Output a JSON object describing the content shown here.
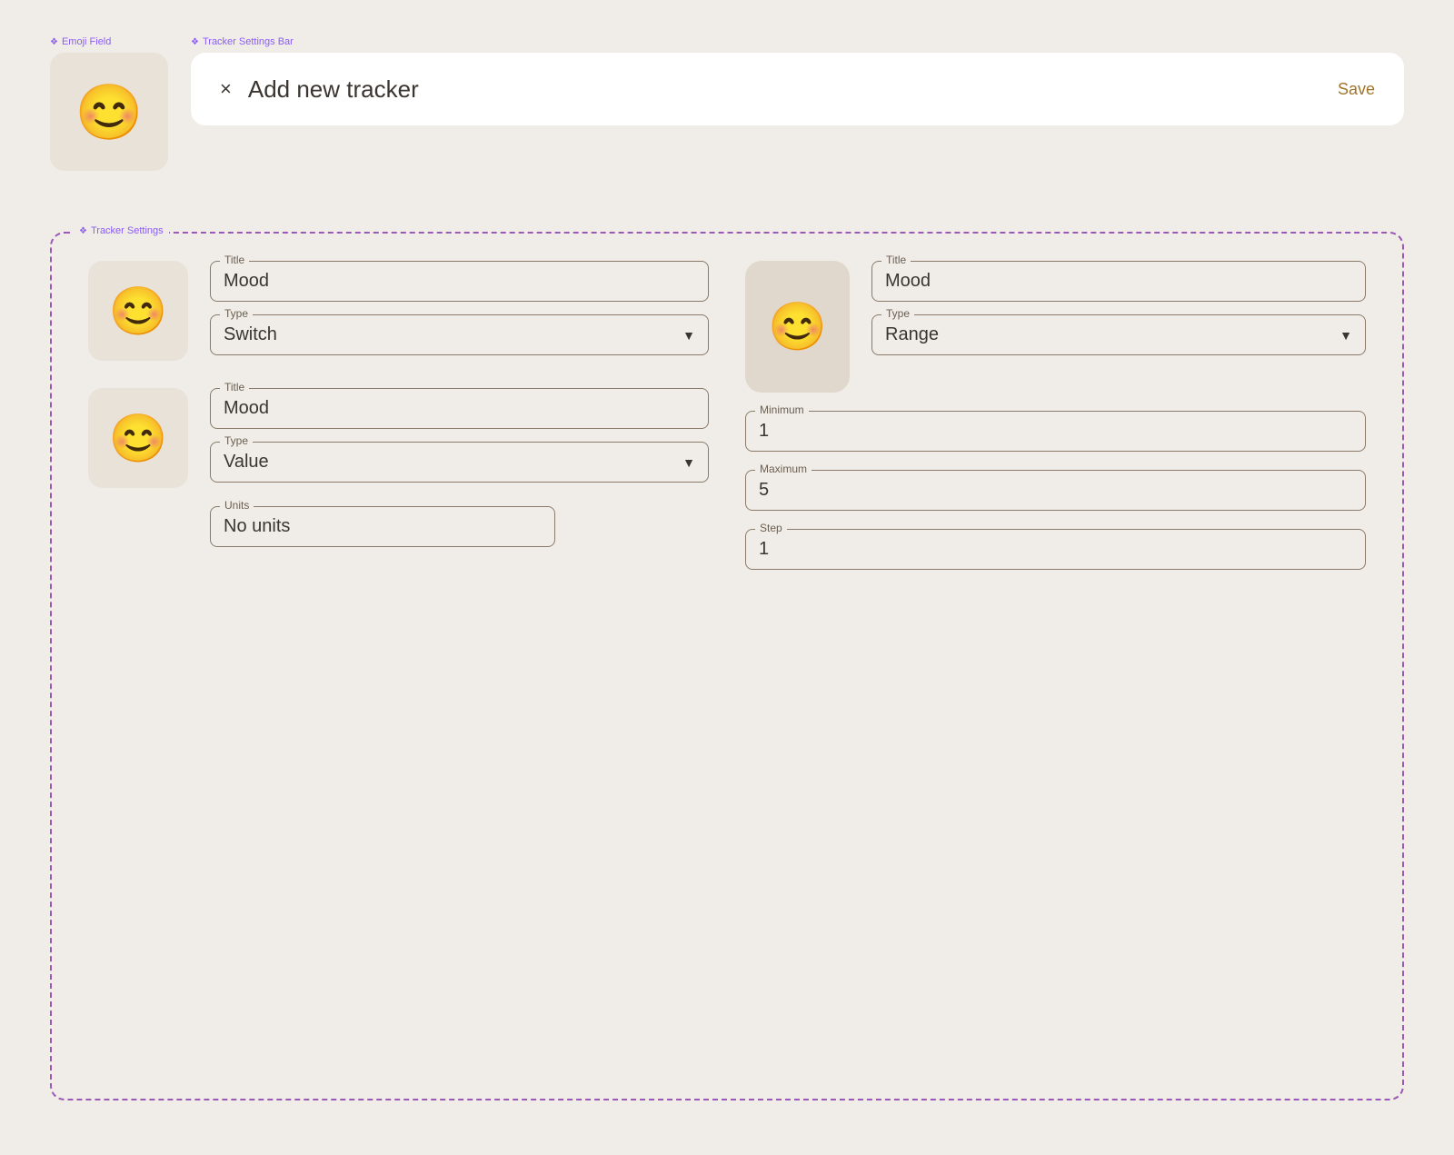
{
  "emoji_field": {
    "label": "Emoji Field",
    "emoji": "😊"
  },
  "tracker_bar": {
    "label": "Tracker Settings Bar",
    "close_label": "×",
    "title": "Add new tracker",
    "save_label": "Save"
  },
  "tracker_settings": {
    "label": "Tracker Settings",
    "card1": {
      "emoji": "😊",
      "title_label": "Title",
      "title_value": "Mood",
      "type_label": "Type",
      "type_value": "Switch"
    },
    "card2": {
      "emoji": "😊",
      "title_label": "Title",
      "title_value": "Mood",
      "type_label": "Type",
      "type_value": "Value",
      "units_label": "Units",
      "units_value": "No units"
    },
    "card3": {
      "emoji": "😊",
      "title_label": "Title",
      "title_value": "Mood",
      "type_label": "Type",
      "type_value": "Range",
      "minimum_label": "Minimum",
      "minimum_value": "1",
      "maximum_label": "Maximum",
      "maximum_value": "5",
      "step_label": "Step",
      "step_value": "1"
    }
  }
}
